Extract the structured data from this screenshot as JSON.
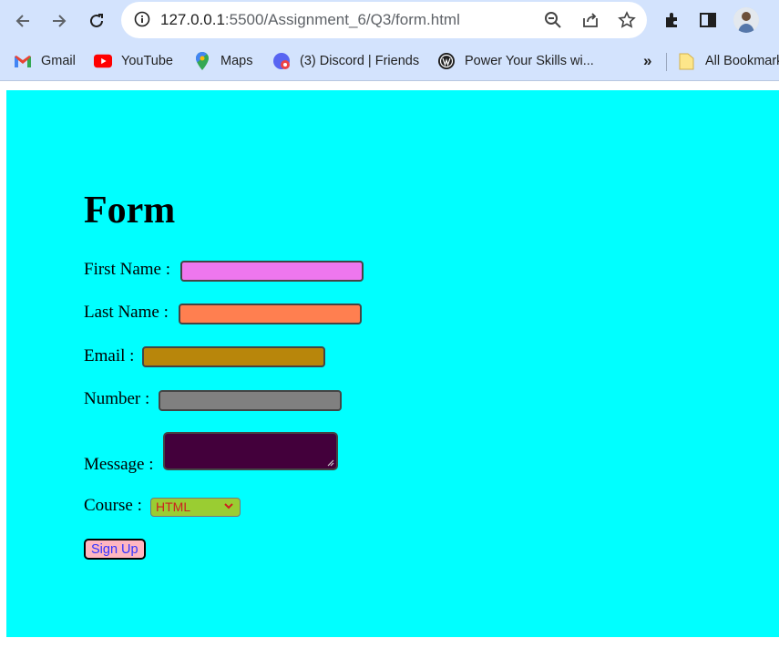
{
  "browser": {
    "url_host": "127.0.0.1",
    "url_rest": ":5500/Assignment_6/Q3/form.html",
    "bookmarks": [
      {
        "label": "Gmail",
        "icon": "gmail-icon"
      },
      {
        "label": "YouTube",
        "icon": "youtube-icon"
      },
      {
        "label": "Maps",
        "icon": "maps-icon"
      },
      {
        "label": "(3) Discord | Friends",
        "icon": "discord-icon"
      },
      {
        "label": "Power Your Skills wi...",
        "icon": "wordpress-icon"
      }
    ],
    "overflow_label": "»",
    "all_bookmarks_label": "All Bookmarks"
  },
  "page": {
    "background": "#00ffff",
    "title": "Form",
    "fields": {
      "first_name": {
        "label": "First Name :",
        "value": "",
        "color": "#ee77ee"
      },
      "last_name": {
        "label": "Last Name :",
        "value": "",
        "color": "#ff7f50"
      },
      "email": {
        "label": "Email :",
        "value": "",
        "color": "#b8860b"
      },
      "number": {
        "label": "Number :",
        "value": "",
        "color": "#808080"
      },
      "message": {
        "label": "Message :",
        "value": "",
        "color": "#43003b"
      }
    },
    "course": {
      "label": "Course :",
      "selected": "HTML",
      "bg_color": "#9acd32",
      "text_color": "#cc2020"
    },
    "submit_label": "Sign Up"
  }
}
